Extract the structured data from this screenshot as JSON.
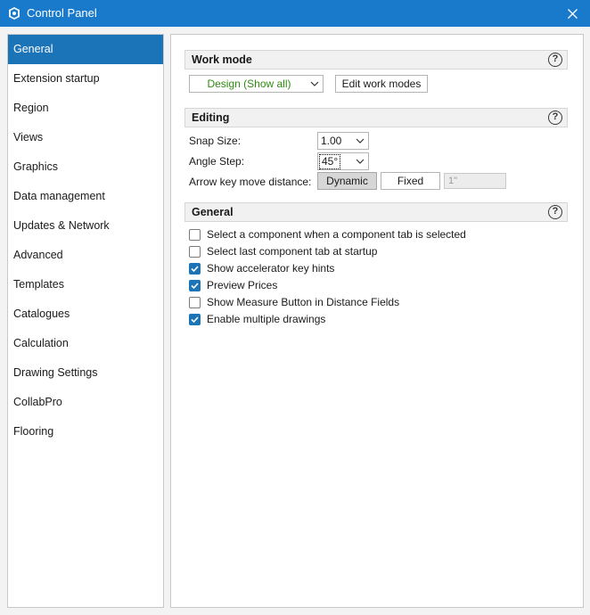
{
  "window": {
    "title": "Control Panel"
  },
  "sidebar": {
    "items": [
      {
        "label": "General",
        "active": true
      },
      {
        "label": "Extension startup"
      },
      {
        "label": "Region"
      },
      {
        "label": "Views"
      },
      {
        "label": "Graphics"
      },
      {
        "label": "Data management"
      },
      {
        "label": "Updates & Network"
      },
      {
        "label": "Advanced"
      },
      {
        "label": "Templates"
      },
      {
        "label": "Catalogues"
      },
      {
        "label": "Calculation"
      },
      {
        "label": "Drawing Settings"
      },
      {
        "label": "CollabPro"
      },
      {
        "label": "Flooring"
      }
    ]
  },
  "work_mode": {
    "title": "Work mode",
    "help": "?",
    "selected": "Design (Show all)",
    "selected_color": "#2e8b0f",
    "edit_button": "Edit work modes"
  },
  "editing": {
    "title": "Editing",
    "help": "?",
    "snap_label": "Snap Size:",
    "snap_value": "1.00",
    "angle_label": "Angle Step:",
    "angle_value": "45°",
    "arrow_label": "Arrow key move distance:",
    "dynamic_button": "Dynamic",
    "fixed_button": "Fixed",
    "distance_value": "1\""
  },
  "general": {
    "title": "General",
    "help": "?",
    "options": [
      {
        "label": "Select a component when a component tab is selected",
        "checked": false
      },
      {
        "label": "Select last component tab at startup",
        "checked": false
      },
      {
        "label": "Show accelerator key hints",
        "checked": true
      },
      {
        "label": "Preview Prices",
        "checked": true
      },
      {
        "label": "Show Measure Button in Distance Fields",
        "checked": false
      },
      {
        "label": "Enable multiple drawings",
        "checked": true
      }
    ]
  },
  "colors": {
    "titlebar": "#1979ca",
    "selection": "#1b74b8"
  },
  "icons": {
    "app": "gear-shield-icon",
    "close": "close-icon",
    "dropdown": "chevron-down-icon",
    "check": "checkmark-icon",
    "help": "help-icon"
  }
}
